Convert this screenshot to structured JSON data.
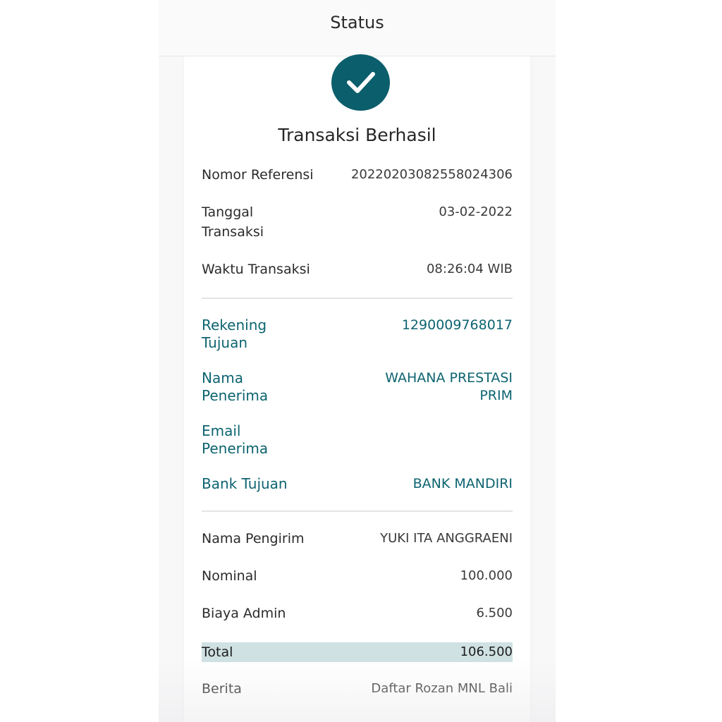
{
  "app_bar": {
    "title": "Status"
  },
  "receipt": {
    "title": "Transaksi Berhasil",
    "transaction": [
      {
        "label": "Nomor Referensi",
        "value": "20220203082558024306"
      },
      {
        "label": "Tanggal Transaksi",
        "value": "03-02-2022"
      },
      {
        "label": "Waktu Transaksi",
        "value": "08:26:04 WIB"
      }
    ],
    "recipient": [
      {
        "label": "Rekening Tujuan",
        "value": "1290009768017"
      },
      {
        "label": "Nama Penerima",
        "value": "WAHANA PRESTASI PRIM"
      },
      {
        "label": "Email Penerima",
        "value": ""
      },
      {
        "label": "Bank Tujuan",
        "value": "BANK MANDIRI"
      }
    ],
    "payment": [
      {
        "label": "Nama Pengirim",
        "value": "YUKI ITA ANGGRAENI"
      },
      {
        "label": "Nominal",
        "value": "100.000"
      },
      {
        "label": "Biaya Admin",
        "value": "6.500"
      },
      {
        "label": "Total",
        "value": "106.500"
      },
      {
        "label": "Berita",
        "value": "Daftar Rozan MNL Bali"
      }
    ]
  },
  "colors": {
    "accent": "#0b5e6b",
    "total_highlight": "#cfe1e3"
  },
  "icons": {
    "status": "check-icon"
  }
}
